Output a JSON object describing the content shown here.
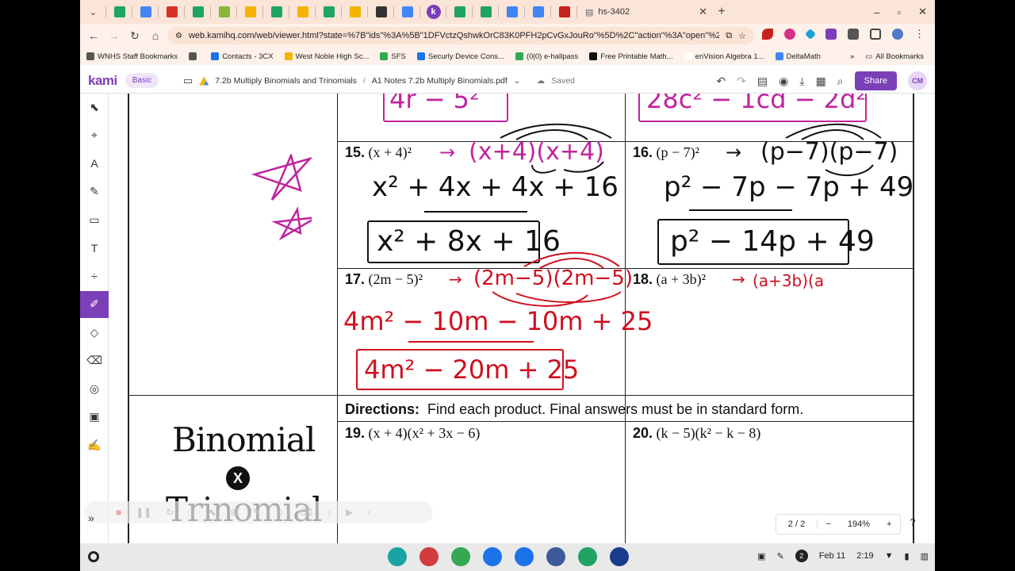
{
  "browser": {
    "tabs": [
      {
        "icon": "sheets-icon",
        "color": "#1fa463"
      },
      {
        "icon": "calendar-icon",
        "color": "#4285f4"
      },
      {
        "icon": "gmail-icon",
        "color": "#d93025"
      },
      {
        "icon": "drive-icon",
        "color": "#1fa463"
      },
      {
        "icon": "classroom-icon",
        "color": "#8bb53b"
      },
      {
        "icon": "slides-icon",
        "color": "#f4b400"
      },
      {
        "icon": "sheets-icon",
        "color": "#1fa463"
      },
      {
        "icon": "slides-icon",
        "color": "#f4b400"
      },
      {
        "icon": "sheets-icon",
        "color": "#1fa463"
      },
      {
        "icon": "slides-icon",
        "color": "#f4b400"
      },
      {
        "icon": "edpuzzle-icon",
        "color": "#333333"
      },
      {
        "icon": "link-icon",
        "color": "#4285f4"
      }
    ],
    "tabs_after": [
      {
        "icon": "sheets-icon",
        "color": "#1fa463"
      },
      {
        "icon": "sheets-icon",
        "color": "#1fa463"
      },
      {
        "icon": "google-icon",
        "color": "#4285f4"
      },
      {
        "icon": "docs-icon",
        "color": "#4285f4"
      },
      {
        "icon": "record-icon",
        "color": "#c5221f"
      }
    ],
    "current_tab_title": "hs-3402",
    "url": "web.kamihq.com/web/viewer.html?state=%7B\"ids\"%3A%5B\"1DFVctzQshwkOrC83K0PFH2pCvGxJouRo\"%5D%2C\"action\"%3A\"open\"%2C\"userId\"%3A...",
    "bookmarks": [
      {
        "label": "WNHS Staff Bookmarks",
        "color": "#555555"
      },
      {
        "label": "",
        "color": "#555555"
      },
      {
        "label": "Contacts - 3CX",
        "color": "#1a73e8"
      },
      {
        "label": "West Noble High Sc...",
        "color": "#f4b400"
      },
      {
        "label": "SFS",
        "color": "#34a853"
      },
      {
        "label": "Securly Device Cons...",
        "color": "#1a73e8"
      },
      {
        "label": "(0|0) e-hallpass",
        "color": "#34a853"
      },
      {
        "label": "Free Printable Math...",
        "color": "#111111"
      },
      {
        "label": "enVision Algebra 1...",
        "color": "#ffffff"
      },
      {
        "label": "DeltaMath",
        "color": "#4285f4"
      }
    ],
    "all_bookmarks": "All Bookmarks"
  },
  "kami": {
    "logo": "kami",
    "plan": "Basic",
    "folder": "7.2b Multiply Binomials and Trinomials",
    "separator": "/",
    "file": "A1 Notes 7.2b Multiply Binomials.pdf",
    "save_status": "Saved",
    "share": "Share",
    "avatar": "CM",
    "accent": "#7b3fb8"
  },
  "tools": [
    {
      "name": "select-tool-icon",
      "glyph": "⬉"
    },
    {
      "name": "text-select-tool-icon",
      "glyph": "⌖"
    },
    {
      "name": "markup-tool-icon",
      "glyph": "A"
    },
    {
      "name": "highlight-tool-icon",
      "glyph": "✎"
    },
    {
      "name": "comment-tool-icon",
      "glyph": "▭"
    },
    {
      "name": "text-box-tool-icon",
      "glyph": "T"
    },
    {
      "name": "equation-tool-icon",
      "glyph": "÷"
    },
    {
      "name": "drawing-tool-icon",
      "glyph": "✐"
    },
    {
      "name": "shapes-tool-icon",
      "glyph": "◇"
    },
    {
      "name": "eraser-tool-icon",
      "glyph": "⌫"
    },
    {
      "name": "add-media-tool-icon",
      "glyph": "◎"
    },
    {
      "name": "image-tool-icon",
      "glyph": "▣"
    },
    {
      "name": "signature-tool-icon",
      "glyph": "✍"
    }
  ],
  "worksheet": {
    "partial_top_left": "4r − 5²",
    "partial_top_right": "28c² − 1cd − 2d²",
    "problems": {
      "p15": {
        "num": "15.",
        "expr": "(x + 4)²"
      },
      "p16": {
        "num": "16.",
        "expr": "(p − 7)²"
      },
      "p17": {
        "num": "17.",
        "expr": "(2m − 5)²"
      },
      "p18": {
        "num": "18.",
        "expr": "(a + 3b)²"
      },
      "p19": {
        "num": "19.",
        "expr": "(x + 4)(x² + 3x − 6)"
      },
      "p20": {
        "num": "20.",
        "expr": "(k − 5)(k² − k − 8)"
      }
    },
    "work": {
      "p15_setup": "(x+4)(x+4)",
      "p15_expand": "x² + 4x + 4x + 16",
      "p15_answer": "x² + 8x + 16",
      "p16_setup": "(p−7)(p−7)",
      "p16_expand": "p² − 7p − 7p + 49",
      "p16_answer": "p² − 14p + 49",
      "p17_setup": "(2m−5)(2m−5)",
      "p17_expand": "4m² − 10m − 10m + 25",
      "p17_answer": "4m² − 20m + 25",
      "p18_setup": "(a+3b)(a"
    },
    "arrow": "→",
    "directions_label": "Directions:",
    "directions_text": "Find each product.  Final answers must be in standard form.",
    "section_title_1": "Binomial",
    "section_title_x": "X",
    "section_title_2": "Trinomial"
  },
  "viewer": {
    "page": "2 / 2",
    "zoom": "194%",
    "zoom_out": "−",
    "zoom_in": "+",
    "help": "?"
  },
  "shelf": {
    "apps": [
      {
        "name": "camera-app-icon",
        "color": "#1aa3a3"
      },
      {
        "name": "canva-app-icon",
        "color": "#d23c3c"
      },
      {
        "name": "chrome-app-icon",
        "color": "#34a853"
      },
      {
        "name": "files-app-icon",
        "color": "#1a73e8"
      },
      {
        "name": "kami-app-icon",
        "color": "#1a73e8"
      },
      {
        "name": "add-app-icon",
        "color": "#3c5a99"
      },
      {
        "name": "classroom-app-icon",
        "color": "#1fa463"
      },
      {
        "name": "epson-app-icon",
        "color": "#1a3c8c"
      }
    ],
    "notifications": "2",
    "date": "Feb 11",
    "time": "2:19"
  }
}
